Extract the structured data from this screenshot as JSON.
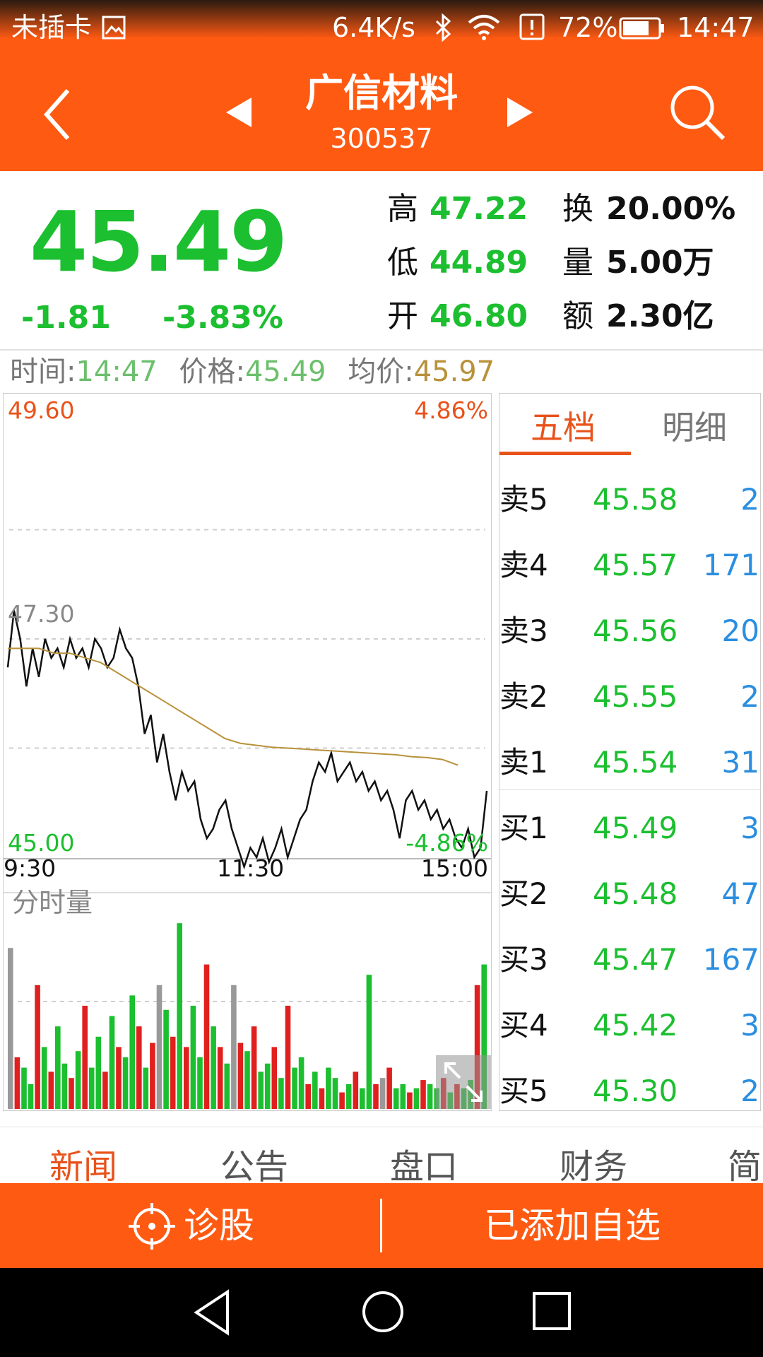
{
  "status_bar": {
    "carrier": "未插卡",
    "net_speed": "6.4K/s",
    "battery": "72%",
    "time": "14:47"
  },
  "header": {
    "stock_name": "广信材料",
    "stock_code": "300537"
  },
  "quote": {
    "price": "45.49",
    "change": "-1.81",
    "change_pct": "-3.83%",
    "high_label": "高",
    "high": "47.22",
    "low_label": "低",
    "low": "44.89",
    "open_label": "开",
    "open": "46.80",
    "turnover_label": "换",
    "turnover": "20.00%",
    "volume_label": "量",
    "volume": "5.00万",
    "amount_label": "额",
    "amount": "2.30亿"
  },
  "info_line": {
    "time_label": "时间:",
    "time": "14:47",
    "price_label": "价格:",
    "price": "45.49",
    "avg_label": "均价:",
    "avg": "45.97"
  },
  "chart_data": {
    "type": "line",
    "x_ticks": [
      "9:30",
      "11:30",
      "15:00"
    ],
    "ylim": [
      45.0,
      49.6
    ],
    "y_ticks_left": [
      "49.60",
      "47.30",
      "45.00"
    ],
    "y_ticks_right": [
      "4.86%",
      "-4.86%"
    ],
    "series": [
      {
        "values": [
          47.0,
          47.6,
          47.3,
          46.8,
          47.2,
          46.9,
          47.3,
          47.1,
          47.2,
          47.0,
          47.3,
          47.1,
          47.2,
          47.0,
          47.3,
          47.2,
          47.0,
          47.1,
          47.4,
          47.2,
          47.1,
          46.8,
          46.3,
          46.5,
          46.0,
          46.3,
          45.9,
          45.6,
          45.9,
          45.7,
          45.8,
          45.4,
          45.2,
          45.3,
          45.5,
          45.6,
          45.3,
          45.1,
          44.9,
          45.1,
          45.0,
          45.2,
          44.95,
          45.1,
          45.3,
          45.0,
          45.2,
          45.4,
          45.5,
          45.8,
          46.0,
          45.9,
          46.1,
          45.8,
          45.9,
          46.0,
          45.8,
          45.9,
          45.7,
          45.8,
          45.6,
          45.7,
          45.5,
          45.2,
          45.6,
          45.7,
          45.5,
          45.6,
          45.4,
          45.5,
          45.3,
          45.4,
          45.2,
          45.1,
          45.3,
          45.0,
          45.1,
          45.7
        ],
        "color": "#111111"
      },
      {
        "values": [
          47.2,
          47.2,
          47.2,
          47.15,
          47.15,
          47.1,
          47.05,
          46.95,
          46.85,
          46.75,
          46.65,
          46.55,
          46.45,
          46.35,
          46.25,
          46.2,
          46.18,
          46.16,
          46.15,
          46.14,
          46.13,
          46.12,
          46.11,
          46.1,
          46.09,
          46.08,
          46.06,
          46.05,
          46.03,
          45.97
        ],
        "color": "#b8913a"
      }
    ],
    "volume_label": "分时量",
    "volume_colors": [
      "#e0201e",
      "#1bbf2f",
      "#999999"
    ],
    "grid": true
  },
  "order_book": {
    "tabs": [
      "五档",
      "明细"
    ],
    "rows": [
      {
        "label": "卖5",
        "price": "45.58",
        "volume": "2"
      },
      {
        "label": "卖4",
        "price": "45.57",
        "volume": "171"
      },
      {
        "label": "卖3",
        "price": "45.56",
        "volume": "20"
      },
      {
        "label": "卖2",
        "price": "45.55",
        "volume": "2"
      },
      {
        "label": "卖1",
        "price": "45.54",
        "volume": "31"
      },
      {
        "label": "买1",
        "price": "45.49",
        "volume": "3"
      },
      {
        "label": "买2",
        "price": "45.48",
        "volume": "47"
      },
      {
        "label": "买3",
        "price": "45.47",
        "volume": "167"
      },
      {
        "label": "买4",
        "price": "45.42",
        "volume": "3"
      },
      {
        "label": "买5",
        "price": "45.30",
        "volume": "2"
      }
    ]
  },
  "bottom_tabs": [
    "新闻",
    "公告",
    "盘口",
    "财务",
    "简"
  ],
  "actions": {
    "diagnose": "诊股",
    "watchlist": "已添加自选"
  },
  "colors": {
    "accent": "#ff5a12",
    "down": "#1bbf2f",
    "up": "#e0201e",
    "avg_line": "#b8913a",
    "volume_text": "#2b8ee0"
  }
}
